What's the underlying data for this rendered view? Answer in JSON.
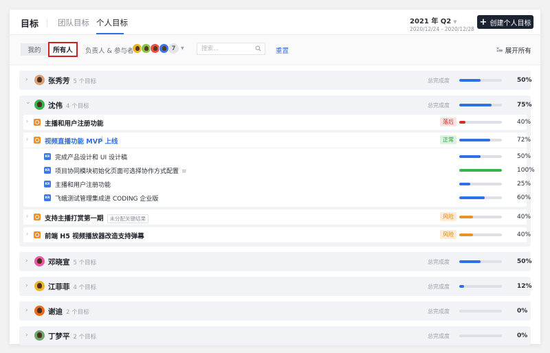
{
  "header": {
    "title": "目标",
    "tabs": [
      {
        "label": "团队目标",
        "active": false
      },
      {
        "label": "个人目标",
        "active": true
      }
    ],
    "period": "2021 年 Q2",
    "period_range": "2020/12/24 - 2020/12/28",
    "create_button": "创建个人目标"
  },
  "toolbar": {
    "segments": [
      {
        "label": "我的",
        "active": false
      },
      {
        "label": "所有人",
        "active": true
      }
    ],
    "owner_filter_label": "负责人 & 参与者",
    "avatar_colors": [
      "#f0b429",
      "#8bc34a",
      "#e5534b",
      "#3a78e8"
    ],
    "more_count": "7",
    "search_placeholder": "搜索...",
    "reset_label": "重置",
    "expand_all_label": "展开所有"
  },
  "progress_label": "总完成度",
  "groups": [
    {
      "name": "张秀芳",
      "count": "5 个目标",
      "avatar_color": "#d9a07a",
      "progress": 50,
      "progress_text": "50%",
      "expanded": false
    },
    {
      "name": "沈伟",
      "count": "4 个目标",
      "avatar_color": "#3bb04f",
      "progress": 75,
      "progress_text": "75%",
      "expanded": true,
      "objectives": [
        {
          "title": "主播和用户注册功能",
          "status": "落后",
          "status_type": "lag",
          "progress": 15,
          "progress_text": "40%",
          "bar_color": "red"
        },
        {
          "title": "视频直播功能 MVP 上线",
          "status": "正常",
          "status_type": "normal",
          "progress": 72,
          "progress_text": "72%",
          "bar_color": "blue",
          "expanded": true,
          "hovered": true,
          "key_results": [
            {
              "title": "完成产品设计和 UI 设计稿",
              "progress": 50,
              "progress_text": "50%",
              "bar_color": "blue"
            },
            {
              "title": "项目协同模块初始化页面可选择协作方式配置",
              "progress": 100,
              "progress_text": "100%",
              "bar_color": "green",
              "has_note": true
            },
            {
              "title": "主播和用户注册功能",
              "progress": 25,
              "progress_text": "25%",
              "bar_color": "blue"
            },
            {
              "title": "飞蛾测试管理集成进 CODING 企业版",
              "progress": 60,
              "progress_text": "60%",
              "bar_color": "blue"
            }
          ]
        },
        {
          "title": "支持主播打赏第一期",
          "tag": "未分配关键结果",
          "status": "风险",
          "status_type": "risk",
          "progress": 33,
          "progress_text": "40%",
          "bar_color": "orange"
        },
        {
          "title": "前端 H5 视频播放器改造支持弹幕",
          "status": "风险",
          "status_type": "risk",
          "progress": 33,
          "progress_text": "40%",
          "bar_color": "orange"
        }
      ]
    },
    {
      "name": "邓晓宣",
      "count": "5 个目标",
      "avatar_color": "#e85aa5",
      "progress": 50,
      "progress_text": "50%",
      "expanded": false
    },
    {
      "name": "江菲菲",
      "count": "4 个目标",
      "avatar_color": "#f0b429",
      "progress": 12,
      "progress_text": "12%",
      "expanded": false
    },
    {
      "name": "谢迪",
      "count": "2 个目标",
      "avatar_color": "#ea6a1c",
      "progress": 0,
      "progress_text": "0%",
      "expanded": false
    },
    {
      "name": "丁梦平",
      "count": "2 个目标",
      "avatar_color": "#6fa86a",
      "progress": 0,
      "progress_text": "0%",
      "expanded": false
    }
  ],
  "icons": {
    "kr_badge": "KR",
    "chevron_right": "›",
    "chevron_down": "⌄"
  }
}
